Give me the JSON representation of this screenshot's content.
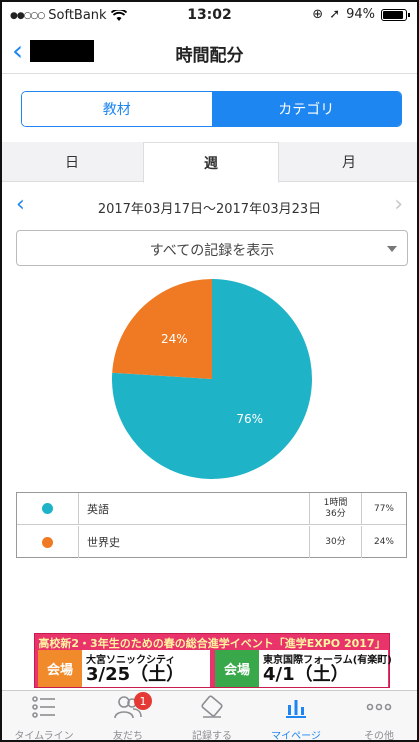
{
  "status_bar": {
    "carrier": "SoftBank",
    "time": "13:02",
    "battery": "94%"
  },
  "navbar": {
    "title": "時間配分",
    "back_icon": "chevron-left-icon"
  },
  "segment": {
    "options": [
      "教材",
      "カテゴリ"
    ],
    "selected": "カテゴリ"
  },
  "tabs": {
    "items": [
      "日",
      "週",
      "月"
    ],
    "selected": "週"
  },
  "date_range": {
    "label": "2017年03月17日〜2017年03月23日"
  },
  "filter": {
    "label": "すべての記録を表示"
  },
  "chart_data": {
    "type": "pie",
    "categories": [
      "英語",
      "世界史"
    ],
    "values": [
      76,
      24
    ],
    "labels": [
      "76%",
      "24%"
    ],
    "colors": [
      "#1fb3c8",
      "#f07a23"
    ]
  },
  "legend": {
    "rows": [
      {
        "name": "英語",
        "duration_line1": "1時間",
        "duration_line2": "36分",
        "percent": "77%",
        "color": "#1fb3c8"
      },
      {
        "name": "世界史",
        "duration_line1": "30分",
        "duration_line2": "",
        "percent": "24%",
        "color": "#f07a23"
      }
    ]
  },
  "ad": {
    "headline": "高校新2・3年生のための春の総合進学イベント「進学EXPO 2017」",
    "tag1": "会場",
    "venue1": "大宮ソニックシティ",
    "date1": "3/25（土）",
    "tag2": "会場",
    "venue2": "東京国際フォーラム(有楽町)",
    "date2": "4/1（土）"
  },
  "tab_bar": {
    "items": [
      {
        "label": "タイムライン",
        "icon": "list-icon"
      },
      {
        "label": "友だち",
        "icon": "people-icon",
        "badge": "1"
      },
      {
        "label": "記録する",
        "icon": "eraser-icon"
      },
      {
        "label": "マイページ",
        "icon": "bar-chart-icon"
      },
      {
        "label": "その他",
        "icon": "more-icon"
      }
    ],
    "selected": "マイページ"
  }
}
